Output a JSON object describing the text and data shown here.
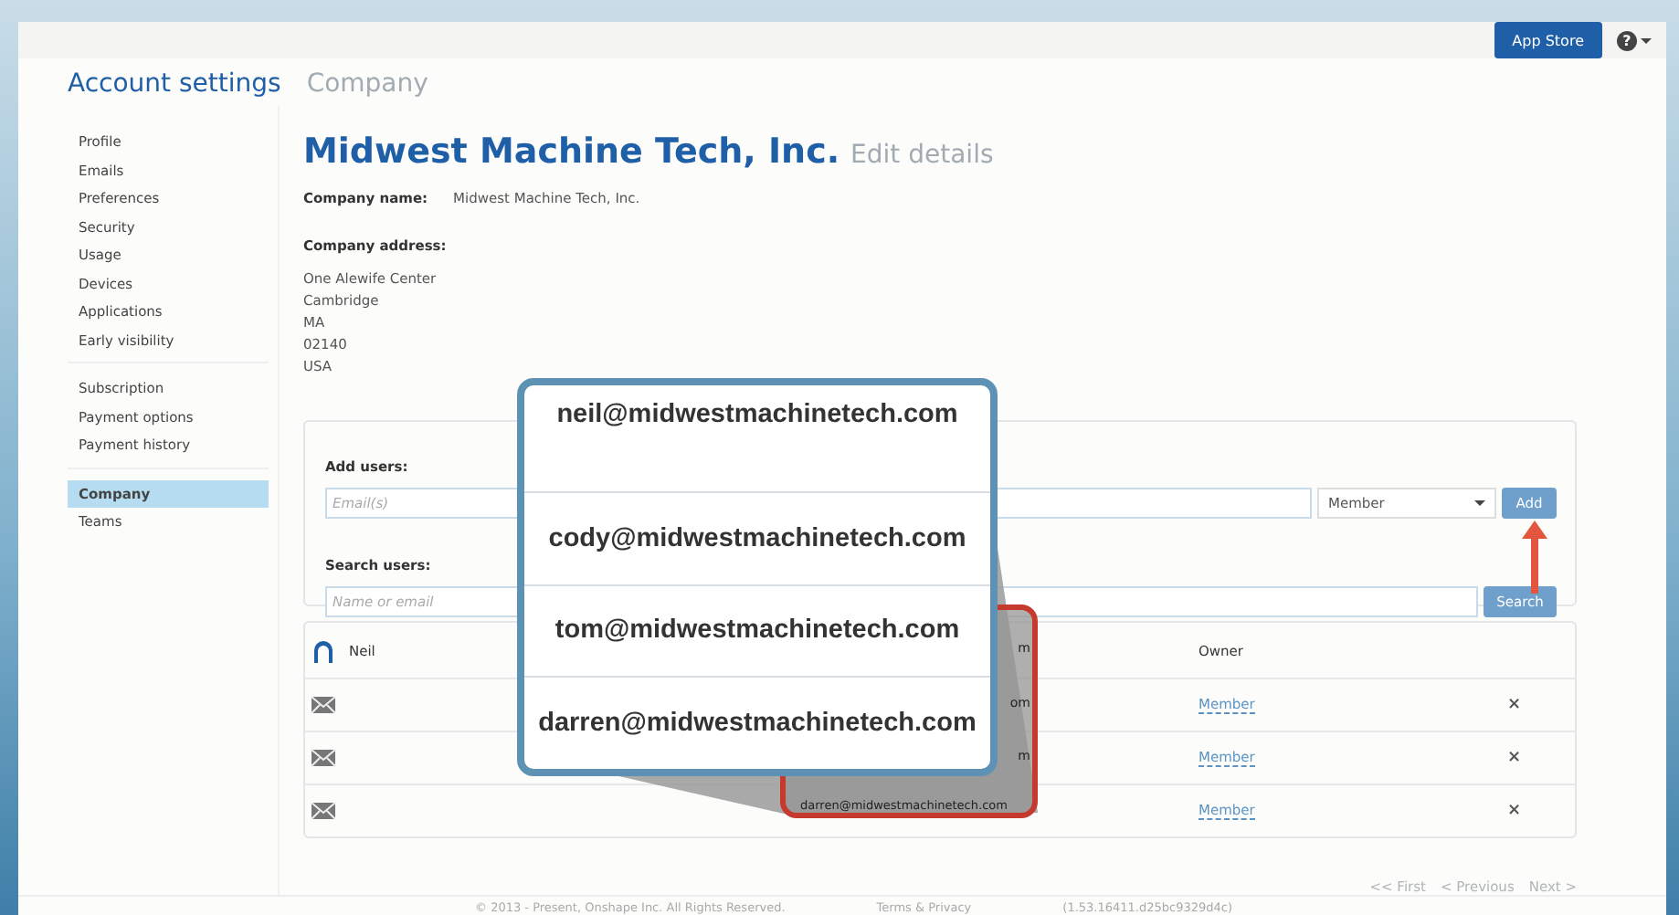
{
  "top_bar": {
    "app_store": "App Store",
    "help": "?"
  },
  "header": {
    "title": "Account settings",
    "subtitle": "Company"
  },
  "sidebar": {
    "groups": [
      [
        {
          "label": "Profile",
          "selected": false
        },
        {
          "label": "Emails",
          "selected": false
        },
        {
          "label": "Preferences",
          "selected": false
        },
        {
          "label": "Security",
          "selected": false
        },
        {
          "label": "Usage",
          "selected": false
        },
        {
          "label": "Devices",
          "selected": false
        },
        {
          "label": "Applications",
          "selected": false
        },
        {
          "label": "Early visibility",
          "selected": false
        }
      ],
      [
        {
          "label": "Subscription",
          "selected": false
        },
        {
          "label": "Payment options",
          "selected": false
        },
        {
          "label": "Payment history",
          "selected": false
        }
      ],
      [
        {
          "label": "Company",
          "selected": true
        },
        {
          "label": "Teams",
          "selected": false
        }
      ]
    ]
  },
  "company": {
    "name": "Midwest Machine Tech, Inc.",
    "edit_link": "Edit details",
    "name_label": "Company name:",
    "name_value": "Midwest Machine Tech, Inc.",
    "address_label": "Company address:",
    "address_lines": [
      "One Alewife Center",
      "Cambridge",
      "MA",
      "02140",
      "USA"
    ]
  },
  "add_users": {
    "label": "Add users:",
    "placeholder": "Email(s)",
    "role": "Member",
    "button": "Add",
    "search_label": "Search users:",
    "search_placeholder": "Name or email",
    "search_button": "Search"
  },
  "members": [
    {
      "kind": "owner",
      "name": "Neil",
      "email": "m",
      "role": "Owner"
    },
    {
      "kind": "invite",
      "email": "om",
      "role": "Member",
      "remove": "×"
    },
    {
      "kind": "invite",
      "email": "m",
      "role": "Member",
      "remove": "×"
    },
    {
      "kind": "invite",
      "email": "darren@midwestmachinetech.com",
      "role": "Member",
      "remove": "×"
    }
  ],
  "pagination": [
    "<< First",
    "< Previous",
    "Next >"
  ],
  "footer": {
    "copyright": "© 2013 - Present, Onshape Inc. All Rights Reserved.",
    "terms": "Terms & Privacy",
    "version": "(1.53.16411.d25bc9329d4c)"
  },
  "callout": {
    "emails": [
      "neil@midwestmachinetech.com",
      "cody@midwestmachinetech.com",
      "tom@midwestmachinetech.com",
      "darren@midwestmachinetech.com"
    ]
  }
}
